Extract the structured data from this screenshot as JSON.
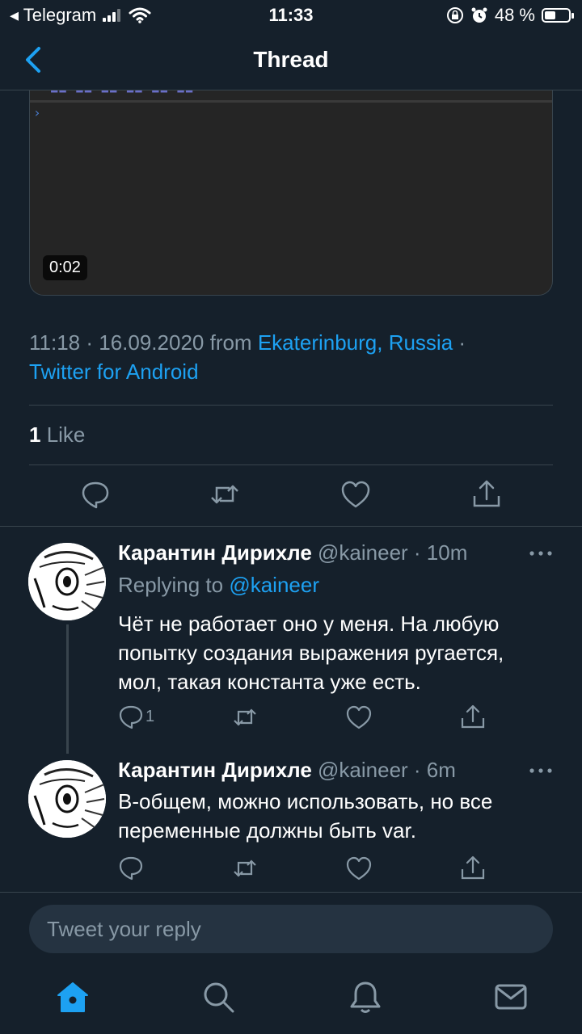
{
  "status_bar": {
    "carrier": "◂ Telegram",
    "time": "11:33",
    "battery_percent": "48 %",
    "battery_level": 0.48
  },
  "header": {
    "title": "Thread"
  },
  "video": {
    "duration": "0:02",
    "console_prompt": "›"
  },
  "tweet_meta": {
    "timestamp": "11:18 · 16.09.2020 from ",
    "location": "Ekaterinburg, Russia",
    "sep": " ·",
    "source": "Twitter for Android"
  },
  "likes": {
    "count": "1",
    "label": " Like"
  },
  "replies": [
    {
      "name": "Карантин Дирихле",
      "handle": " @kaineer · 10m",
      "replying_label": "Replying to ",
      "replying_to": "@kaineer",
      "text": "Чёт не работает оно у меня. На любую попытку создания выражения ругается, мол, такая константа уже есть.",
      "reply_count": "1"
    },
    {
      "name": "Карантин Дирихле",
      "handle": " @kaineer · 6m",
      "text": "В-общем, можно использовать, но все переменные должны быть var."
    }
  ],
  "reply_box": {
    "placeholder": "Tweet your reply"
  },
  "colors": {
    "background": "#15202b",
    "accent": "#1da1f2",
    "muted": "#8899a6",
    "border": "#38444d"
  },
  "icons": [
    "back-chevron-icon",
    "reply-icon",
    "retweet-icon",
    "like-icon",
    "share-icon",
    "more-icon",
    "home-icon",
    "search-icon",
    "notifications-icon",
    "messages-icon"
  ]
}
